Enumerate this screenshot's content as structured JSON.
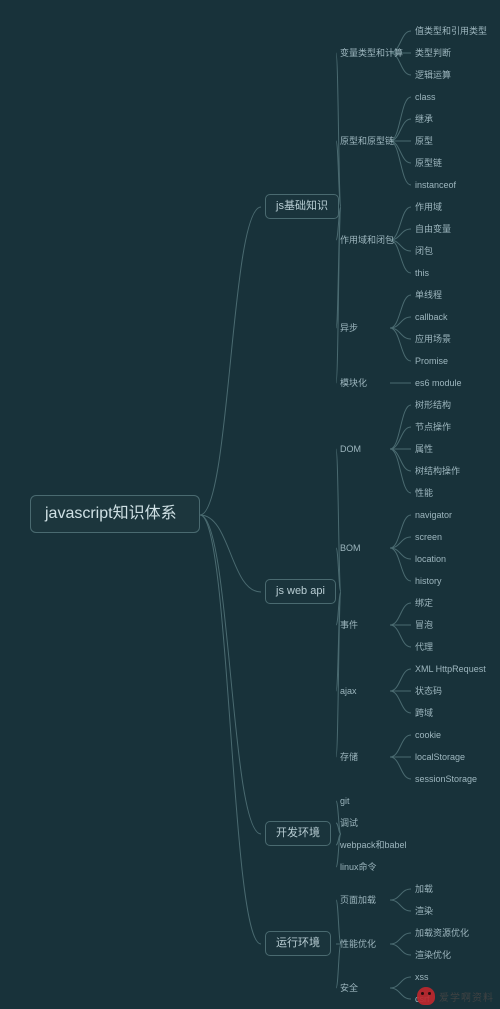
{
  "colors": {
    "bg": "#18323a",
    "line": "#4a6a70",
    "text": "#a0b8bf"
  },
  "watermark": "爱学啊资料",
  "root": {
    "label": "javascript知识体系",
    "children": [
      {
        "label": "js基础知识",
        "children": [
          {
            "label": "变量类型和计算",
            "children": [
              {
                "label": "值类型和引用类型"
              },
              {
                "label": "类型判断"
              },
              {
                "label": "逻辑运算"
              }
            ]
          },
          {
            "label": "原型和原型链",
            "children": [
              {
                "label": "class"
              },
              {
                "label": "继承"
              },
              {
                "label": "原型"
              },
              {
                "label": "原型链"
              },
              {
                "label": "instanceof"
              }
            ]
          },
          {
            "label": "作用域和闭包",
            "children": [
              {
                "label": "作用域"
              },
              {
                "label": "自由变量"
              },
              {
                "label": "闭包"
              },
              {
                "label": "this"
              }
            ]
          },
          {
            "label": "异步",
            "children": [
              {
                "label": "单线程"
              },
              {
                "label": "callback"
              },
              {
                "label": "应用场景"
              },
              {
                "label": "Promise"
              }
            ]
          },
          {
            "label": "模块化",
            "children": [
              {
                "label": "es6 module"
              }
            ]
          }
        ]
      },
      {
        "label": "js web api",
        "children": [
          {
            "label": "DOM",
            "children": [
              {
                "label": "树形结构"
              },
              {
                "label": "节点操作"
              },
              {
                "label": "属性"
              },
              {
                "label": "树结构操作"
              },
              {
                "label": "性能"
              }
            ]
          },
          {
            "label": "BOM",
            "children": [
              {
                "label": "navigator"
              },
              {
                "label": "screen"
              },
              {
                "label": "location"
              },
              {
                "label": "history"
              }
            ]
          },
          {
            "label": "事件",
            "children": [
              {
                "label": "绑定"
              },
              {
                "label": "冒泡"
              },
              {
                "label": "代理"
              }
            ]
          },
          {
            "label": "ajax",
            "children": [
              {
                "label": "XML HttpRequest"
              },
              {
                "label": "状态码"
              },
              {
                "label": "跨域"
              }
            ]
          },
          {
            "label": "存储",
            "children": [
              {
                "label": "cookie"
              },
              {
                "label": "localStorage"
              },
              {
                "label": "sessionStorage"
              }
            ]
          }
        ]
      },
      {
        "label": "开发环境",
        "children": [
          {
            "label": "git"
          },
          {
            "label": "调试"
          },
          {
            "label": "webpack和babel"
          },
          {
            "label": "linux命令"
          }
        ]
      },
      {
        "label": "运行环境",
        "children": [
          {
            "label": "页面加载",
            "children": [
              {
                "label": "加载"
              },
              {
                "label": "渲染"
              }
            ]
          },
          {
            "label": "性能优化",
            "children": [
              {
                "label": "加载资源优化"
              },
              {
                "label": "渲染优化"
              }
            ]
          },
          {
            "label": "安全",
            "children": [
              {
                "label": "xss"
              },
              {
                "label": "csrf"
              }
            ]
          }
        ]
      }
    ]
  }
}
